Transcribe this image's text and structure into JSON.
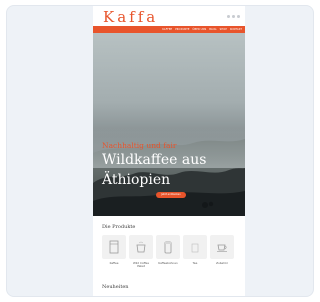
{
  "brand": {
    "logo": "Kaffa",
    "accent": "#e8542b"
  },
  "nav": {
    "items": [
      "KAFFEE",
      "PRODUKTE",
      "ÜBER UNS",
      "BLOG",
      "SHOP",
      "KONTAKT"
    ]
  },
  "hero": {
    "eyebrow": "Nachhaltig und fair",
    "title": "Wildkaffee aus Äthiopien",
    "cta": "Jetzt entdecken"
  },
  "products_section": {
    "title": "Die Produkte",
    "items": [
      {
        "label": "Kaffee",
        "icon": "coffee-bag-icon"
      },
      {
        "label": "Wild Coffee Paket",
        "icon": "cup-icon"
      },
      {
        "label": "Kaffeebohnen",
        "icon": "jar-icon"
      },
      {
        "label": "Tee",
        "icon": "tea-icon"
      },
      {
        "label": "Zubehör",
        "icon": "cup-saucer-icon"
      }
    ]
  },
  "news_section": {
    "title": "Neuheiten"
  }
}
